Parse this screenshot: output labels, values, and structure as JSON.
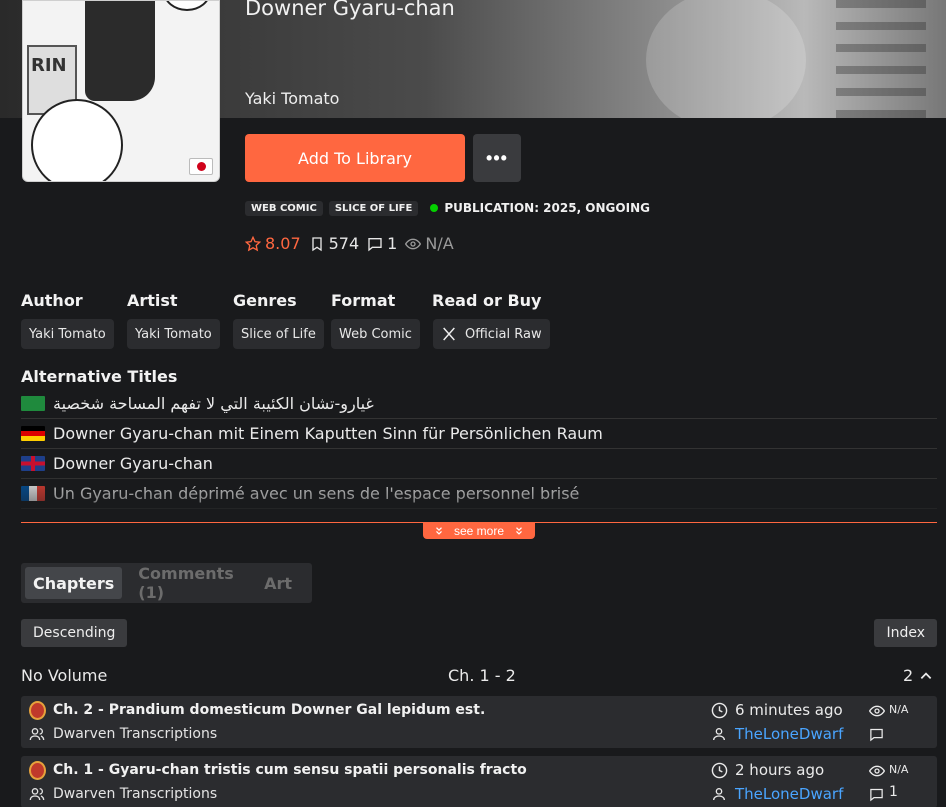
{
  "manga": {
    "title": "Downer Gyaru-chan",
    "author": "Yaki Tomato"
  },
  "actions": {
    "add_to_library": "Add To Library",
    "more": "•••"
  },
  "tags": [
    "Web Comic",
    "Slice of Life"
  ],
  "publication": "PUBLICATION: 2025, ONGOING",
  "stats": {
    "rating": "8.07",
    "follows": "574",
    "comments": "1",
    "views": "N/A"
  },
  "info": {
    "author_label": "Author",
    "author_value": "Yaki Tomato",
    "artist_label": "Artist",
    "artist_value": "Yaki Tomato",
    "genres_label": "Genres",
    "genres_value": "Slice of Life",
    "format_label": "Format",
    "format_value": "Web Comic",
    "read_label": "Read or Buy",
    "read_value": "Official Raw"
  },
  "alt_titles_heading": "Alternative Titles",
  "alt_titles": [
    {
      "lang": "ar",
      "text": "غيارو-تشان الكئيبة التي لا تفهم المساحة شخصية"
    },
    {
      "lang": "de",
      "text": "Downer Gyaru-chan mit Einem Kaputten Sinn für Persönlichen Raum"
    },
    {
      "lang": "en",
      "text": "Downer Gyaru-chan"
    },
    {
      "lang": "fr",
      "text": "Un Gyaru-chan déprimé avec un sens de l'espace personnel brisé"
    }
  ],
  "see_more": "see more",
  "tabs": {
    "chapters": "Chapters",
    "comments": "Comments (1)",
    "art": "Art"
  },
  "sort": {
    "order": "Descending",
    "index": "Index"
  },
  "volume": {
    "name": "No Volume",
    "range": "Ch. 1 - 2",
    "count": "2"
  },
  "chapters": [
    {
      "title": "Ch. 2 - Prandium domesticum Downer Gal lepidum est.",
      "group": "Dwarven Transcriptions",
      "time": "6 minutes ago",
      "uploader": "TheLoneDwarf",
      "views": "N/A",
      "comments": ""
    },
    {
      "title": "Ch. 1 - Gyaru-chan tristis cum sensu spatii personalis fracto",
      "group": "Dwarven Transcriptions",
      "time": "2 hours ago",
      "uploader": "TheLoneDwarf",
      "views": "N/A",
      "comments": "1"
    }
  ],
  "colors": {
    "accent": "#ff6740",
    "background": "#191a1c",
    "surface": "#2b2c2f",
    "link": "#4aa5ff",
    "status": "#04d000"
  }
}
